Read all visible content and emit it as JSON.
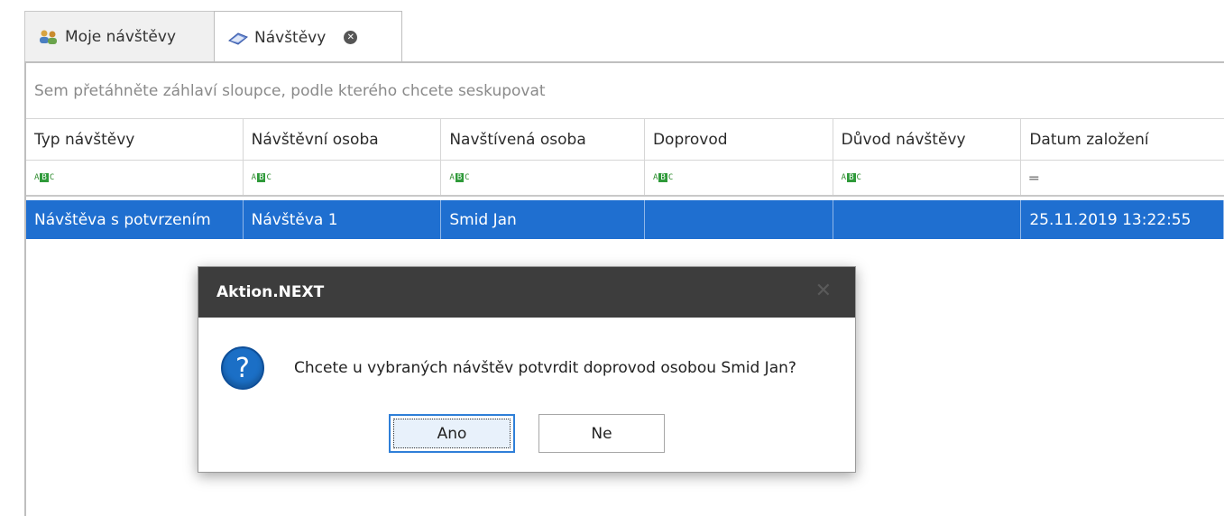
{
  "tabs": [
    {
      "label": "Moje návštěvy",
      "icon": "users-icon",
      "active": false
    },
    {
      "label": "Návštěvy",
      "icon": "book-icon",
      "active": true,
      "closable": true
    }
  ],
  "grid": {
    "group_panel_text": "Sem přetáhněte záhlaví sloupce, podle kterého chcete seskupovat",
    "columns": [
      "Typ návštěvy",
      "Návštěvní osoba",
      "Navštívená osoba",
      "Doprovod",
      "Důvod návštěvy",
      "Datum založení"
    ],
    "filters": [
      "abc-filter-icon",
      "abc-filter-icon",
      "abc-filter-icon",
      "abc-filter-icon",
      "abc-filter-icon",
      "equals-filter-icon"
    ],
    "rows": [
      [
        "Návštěva s potvrzením",
        "Návštěva 1",
        "Smid Jan",
        "",
        "",
        "25.11.2019 13:22:55"
      ]
    ],
    "selection_color": "#1f6fd0"
  },
  "dialog": {
    "title": "Aktion.NEXT",
    "icon": "question-icon",
    "message": "Chcete u vybraných návštěv potvrdit doprovod osobou Smid Jan?",
    "yes_label": "Ano",
    "no_label": "Ne"
  }
}
